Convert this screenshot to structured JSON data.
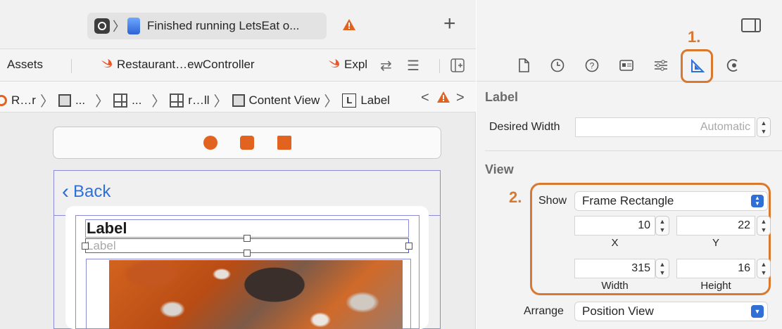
{
  "toolbar": {
    "activity_status": "Finished running LetsEat o...",
    "add_label": "+"
  },
  "tabs": [
    {
      "label": "Assets"
    },
    {
      "label": "Restaurant…ewController"
    },
    {
      "label": "Expl"
    }
  ],
  "jumpbar": {
    "crumbs": [
      "R…r",
      "...",
      "...",
      "r…ll",
      "Content View",
      "Label"
    ],
    "nav_prev": "<",
    "nav_next": ">"
  },
  "canvas": {
    "back_label": "Back",
    "label_title": "Label",
    "label_placeholder": "Label"
  },
  "annotations": {
    "step1": "1.",
    "step2": "2."
  },
  "inspector": {
    "label_section": "Label",
    "desired_width_label": "Desired Width",
    "desired_width_placeholder": "Automatic",
    "view_section": "View",
    "show_label": "Show",
    "show_value": "Frame Rectangle",
    "x_value": "10",
    "y_value": "22",
    "x_label": "X",
    "y_label": "Y",
    "width_value": "315",
    "height_value": "16",
    "width_label": "Width",
    "height_label": "Height",
    "arrange_label": "Arrange",
    "arrange_value": "Position View"
  },
  "colors": {
    "accent_orange": "#d9782f",
    "selection_blue": "#4b5bd6",
    "link_blue": "#2f6fd6"
  }
}
